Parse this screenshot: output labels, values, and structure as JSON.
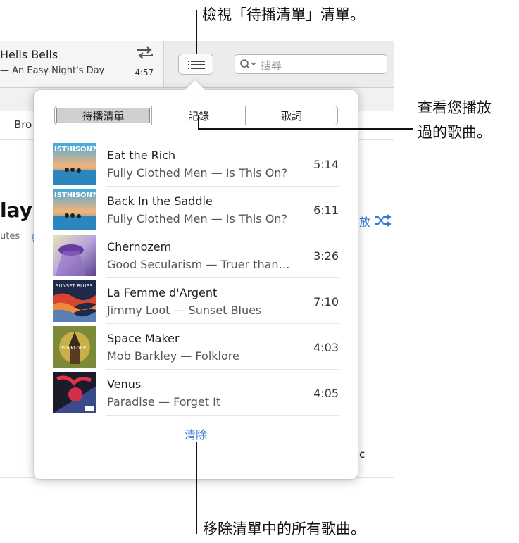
{
  "now_playing": {
    "title": "Hells Bells",
    "subtitle": "— An Easy Night's Day",
    "remaining": "-4:57"
  },
  "search": {
    "placeholder": "搜尋"
  },
  "background": {
    "browse_fragment": "Bro",
    "playlist_fragment": "layl",
    "minutes_fragment": "utes",
    "minutes_link_fragment": "紀",
    "shuffle_fragment": "放",
    "trailing_char": "c"
  },
  "popover": {
    "tabs": [
      {
        "label": "待播清單",
        "active": true
      },
      {
        "label": "記錄",
        "active": false
      },
      {
        "label": "歌詞",
        "active": false
      }
    ],
    "tracks": [
      {
        "title": "Eat the Rich",
        "subtitle": "Fully Clothed Men — Is This On?",
        "duration": "5:14",
        "art": "isthison"
      },
      {
        "title": "Back In the Saddle",
        "subtitle": "Fully Clothed Men — Is This On?",
        "duration": "6:11",
        "art": "isthison"
      },
      {
        "title": "Chernozem",
        "subtitle": "Good Secularism — Truer than…",
        "duration": "3:26",
        "art": "chernozem"
      },
      {
        "title": "La Femme d'Argent",
        "subtitle": "Jimmy Loot — Sunset Blues",
        "duration": "7:10",
        "art": "sunset"
      },
      {
        "title": "Space Maker",
        "subtitle": "Mob Barkley — Folklore",
        "duration": "4:03",
        "art": "folklore"
      },
      {
        "title": "Venus",
        "subtitle": "Paradise — Forget It",
        "duration": "4:05",
        "art": "forgetit"
      }
    ],
    "clear_label": "清除"
  },
  "callouts": {
    "top": "檢視「待播清單」清單。",
    "right_line1": "查看您播放",
    "right_line2": "過的歌曲。",
    "bottom": "移除清單中的所有歌曲。"
  },
  "colors": {
    "accent": "#2e7bd6"
  }
}
